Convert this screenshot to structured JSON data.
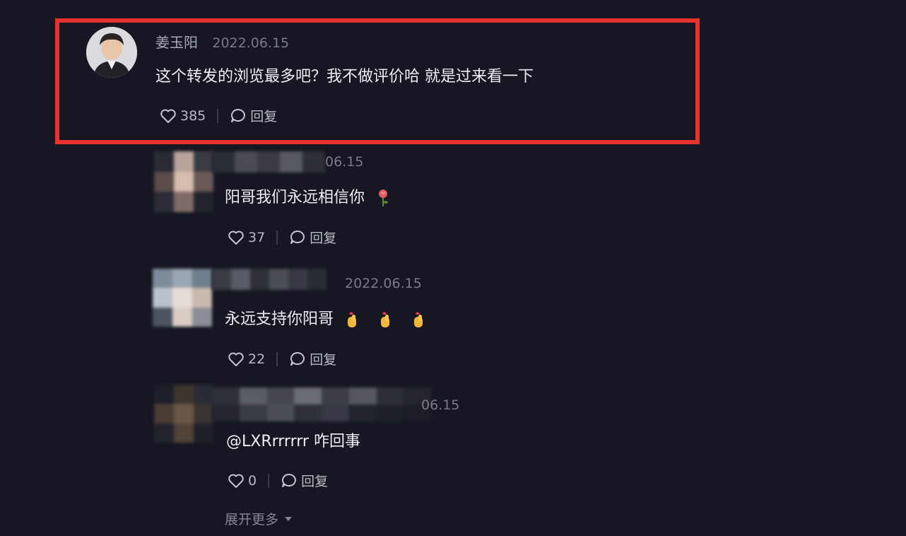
{
  "comments": [
    {
      "username": "姜玉阳",
      "date": "2022.06.15",
      "text": "这个转发的浏览最多吧？我不做评价哈 就是过来看一下",
      "likes": "385",
      "reply_label": "回复"
    },
    {
      "username": "",
      "date": "06.15",
      "text": "阳哥我们永远相信你",
      "emoji": "rose-icon",
      "likes": "37",
      "reply_label": "回复"
    },
    {
      "username": "",
      "date": "2022.06.15",
      "text": "永远支持你阳哥",
      "emoji": "finger-heart-icon",
      "likes": "22",
      "reply_label": "回复"
    },
    {
      "username": "",
      "date": "06.15",
      "text": "@LXRrrrrrr 咋回事",
      "likes": "0",
      "reply_label": "回复"
    }
  ],
  "expand_label": "展开更多",
  "colors": {
    "background": "#161722",
    "highlight": "#e8322d",
    "text": "#eeeef2",
    "muted": "#7a7b86"
  }
}
